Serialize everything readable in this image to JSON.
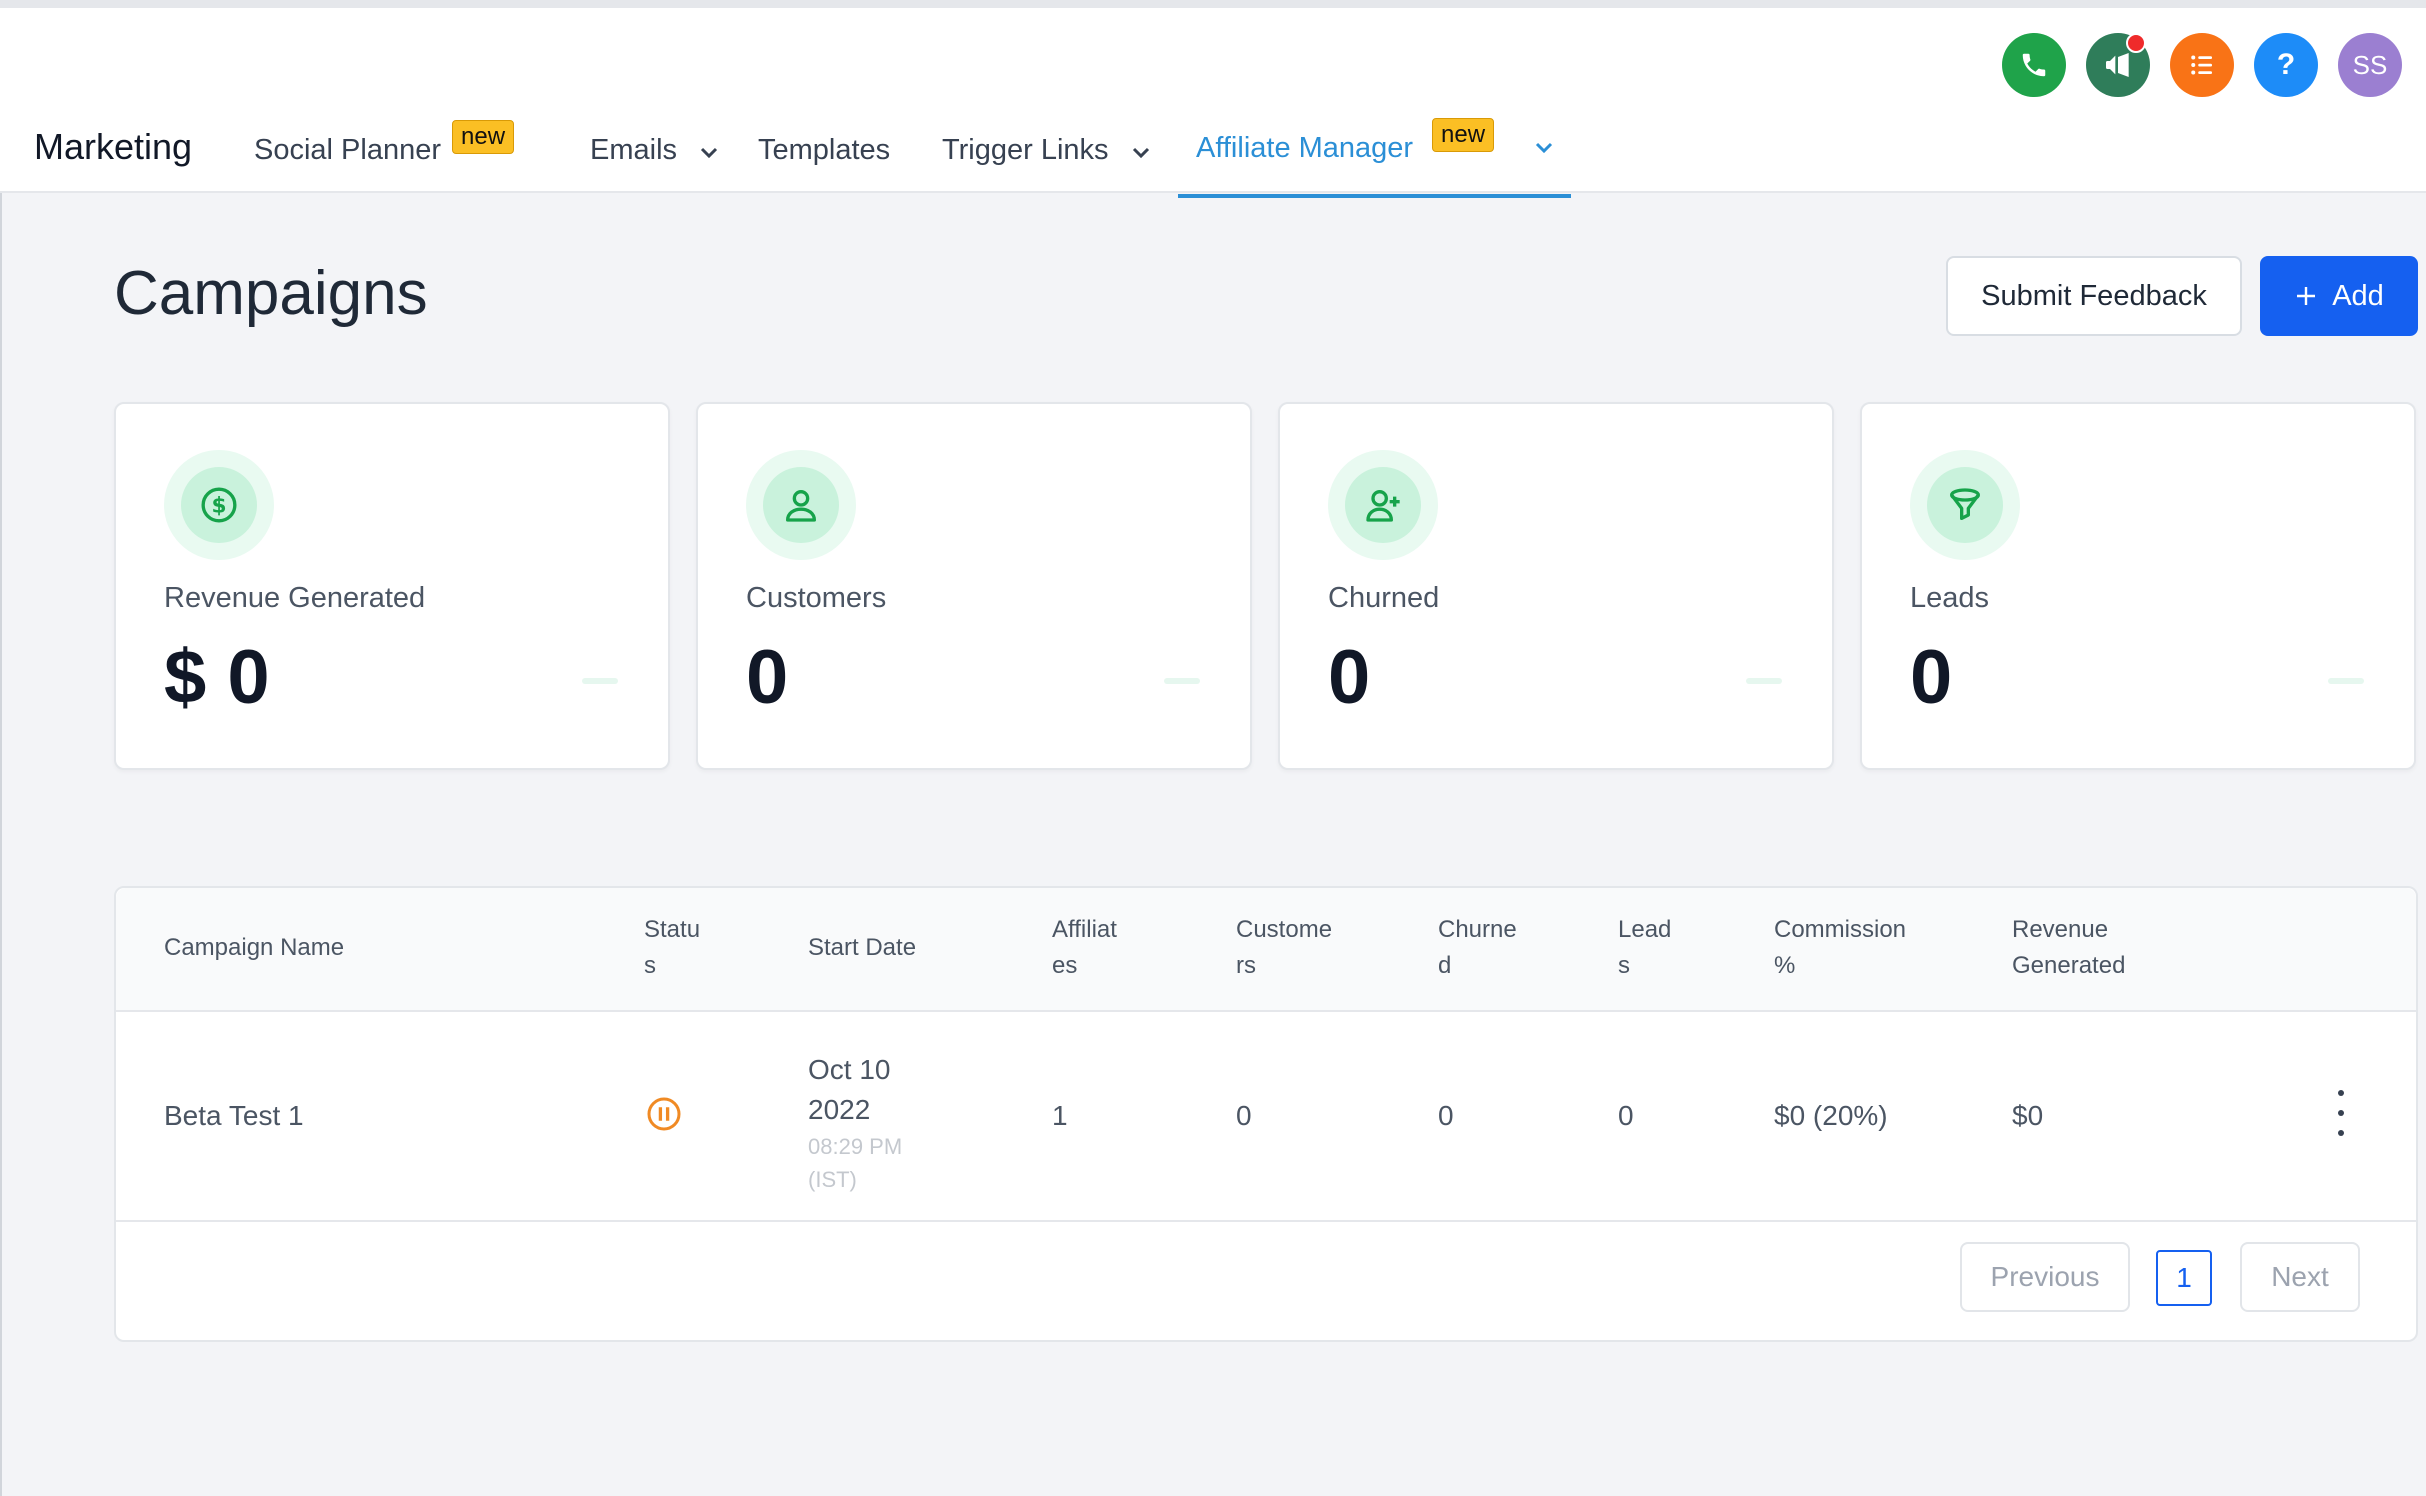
{
  "header": {
    "brand": "Marketing",
    "nav": [
      {
        "label": "Social Planner",
        "badge": "new"
      },
      {
        "label": "Emails"
      },
      {
        "label": "Templates"
      },
      {
        "label": "Trigger Links"
      },
      {
        "label": "Affiliate Manager",
        "badge": "new",
        "active": true
      }
    ],
    "icons": [
      {
        "name": "phone-icon",
        "color": "#1fa34a"
      },
      {
        "name": "megaphone-icon",
        "color": "#2f7d5a",
        "notification": true
      },
      {
        "name": "list-icon",
        "color": "#f97316"
      },
      {
        "name": "help-icon",
        "color": "#1d8cf8"
      },
      {
        "name": "avatar",
        "color": "#9b7fd1",
        "initials": "SS"
      }
    ]
  },
  "page": {
    "title": "Campaigns",
    "feedback_label": "Submit Feedback",
    "add_label": "Add",
    "accent": "#1560f0"
  },
  "stats": [
    {
      "label": "Revenue Generated",
      "value": "$ 0",
      "icon": "dollar-icon"
    },
    {
      "label": "Customers",
      "value": "0",
      "icon": "user-icon"
    },
    {
      "label": "Churned",
      "value": "0",
      "icon": "user-plus-icon"
    },
    {
      "label": "Leads",
      "value": "0",
      "icon": "funnel-icon"
    }
  ],
  "table": {
    "headers": [
      {
        "l1": "Campaign Name"
      },
      {
        "l1": "Statu",
        "l2": "s"
      },
      {
        "l1": "Start Date"
      },
      {
        "l1": "Affiliat",
        "l2": "es"
      },
      {
        "l1": "Custome",
        "l2": "rs"
      },
      {
        "l1": "Churne",
        "l2": "d"
      },
      {
        "l1": "Lead",
        "l2": "s"
      },
      {
        "l1": "Commission",
        "l2": "%"
      },
      {
        "l1": "Revenue",
        "l2": "Generated"
      }
    ],
    "rows": [
      {
        "name": "Beta Test 1",
        "status": "paused",
        "date_line1": "Oct 10",
        "date_line2": "2022",
        "time_line1": "08:29 PM",
        "time_line2": "(IST)",
        "affiliates": "1",
        "customers": "0",
        "churned": "0",
        "leads": "0",
        "commission": "$0 (20%)",
        "revenue": "$0"
      }
    ]
  },
  "pagination": {
    "previous": "Previous",
    "current": "1",
    "next": "Next"
  }
}
